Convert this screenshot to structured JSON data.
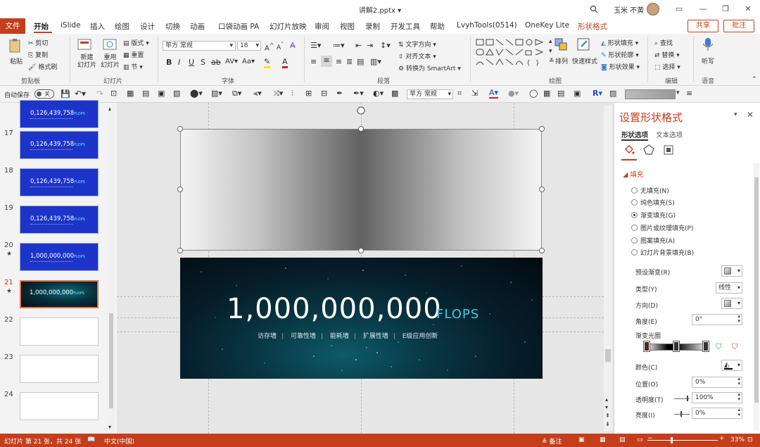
{
  "window": {
    "title": "讲解2.pptx",
    "user": "玉米 不黄",
    "colors": {
      "accent": "#c43e1c",
      "ribbon_bg": "#f3f3f3"
    }
  },
  "tabs": {
    "file": "文件",
    "items": [
      "开始",
      "iSlide",
      "插入",
      "绘图",
      "设计",
      "切换",
      "动画",
      "口袋动画 PA",
      "幻灯片放映",
      "审阅",
      "视图",
      "录制",
      "开发工具",
      "帮助",
      "LvyhTools(0514)",
      "OneKey Lite",
      "形状格式"
    ],
    "share": "共享",
    "comment": "批注"
  },
  "ribbon": {
    "clipboard": {
      "label": "剪贴板",
      "paste": "粘贴",
      "cut": "剪切",
      "copy": "复制",
      "format_painter": "格式刷"
    },
    "slides": {
      "label": "幻灯片",
      "new_slide": "新建\n幻灯片",
      "reuse": "重用\n幻灯片",
      "layout": "版式",
      "reset": "重置",
      "section": "节"
    },
    "font": {
      "label": "字体",
      "font_name": "苹方 常规",
      "font_size": "18"
    },
    "paragraph": {
      "label": "段落",
      "text_direction": "文字方向",
      "align_text": "对齐文本",
      "smartart": "转换为 SmartArt"
    },
    "drawing": {
      "label": "绘图",
      "arrange": "排列",
      "quick_styles": "快速样式",
      "shape_fill": "形状填充",
      "shape_outline": "形状轮廓",
      "shape_effects": "形状效果"
    },
    "editing": {
      "label": "编辑",
      "find": "查找",
      "replace": "替换",
      "select": "选择"
    },
    "voice": {
      "label": "语音",
      "dictate": "听写"
    }
  },
  "qat": {
    "autosave": "自动保存",
    "autosave_state": "关",
    "font_name": "苹方 常规"
  },
  "thumbnails": [
    {
      "num": "",
      "text": "0,126,439,758",
      "unit": "FLOPS",
      "style": "blue"
    },
    {
      "num": "17",
      "text": "0,126,439,758",
      "unit": "FLOPS",
      "style": "blue"
    },
    {
      "num": "18",
      "text": "0,126,439,758",
      "unit": "FLOPS",
      "style": "blue"
    },
    {
      "num": "19",
      "text": "0,126,439,758",
      "unit": "FLOPS",
      "style": "blue"
    },
    {
      "num": "20",
      "text": "1,000,000,000",
      "unit": "FLOPS",
      "style": "blue",
      "star": "★"
    },
    {
      "num": "21",
      "text": "1,000,000,000",
      "unit": "FLOPS",
      "style": "dark",
      "star": "★"
    },
    {
      "num": "22",
      "text": "",
      "unit": "",
      "style": "blank"
    },
    {
      "num": "23",
      "text": "",
      "unit": "",
      "style": "blank"
    },
    {
      "num": "24",
      "text": "",
      "unit": "",
      "style": "blank"
    }
  ],
  "slide": {
    "number": "1,000,000,000",
    "unit": "FLOPS",
    "tags": [
      "访存墙",
      "可靠性墙",
      "能耗墙",
      "扩展性墙",
      "E级应用创新"
    ]
  },
  "format_panel": {
    "title": "设置形状格式",
    "tab_shape": "形状选项",
    "tab_text": "文本选项",
    "fill_section": "填充",
    "fill_options": [
      "无填充(N)",
      "纯色填充(S)",
      "渐变填充(G)",
      "图片或纹理填充(P)",
      "图案填充(A)",
      "幻灯片背景填充(B)"
    ],
    "selected_fill": "渐变填充(G)",
    "preset": "预设渐变(R)",
    "type_label": "类型(Y)",
    "type_value": "线性",
    "direction": "方向(D)",
    "angle_label": "角度(E)",
    "angle_value": "0°",
    "stops_label": "渐变光圈",
    "color_label": "颜色(C)",
    "position_label": "位置(O)",
    "position_value": "0%",
    "transparency_label": "透明度(T)",
    "transparency_value": "100%",
    "brightness_label": "亮度(I)",
    "brightness_value": "0%"
  },
  "status": {
    "slide_info": "幻灯片 第 21 张，共 24 张",
    "language": "中文(中国)",
    "notes": "备注",
    "zoom": "33%"
  }
}
